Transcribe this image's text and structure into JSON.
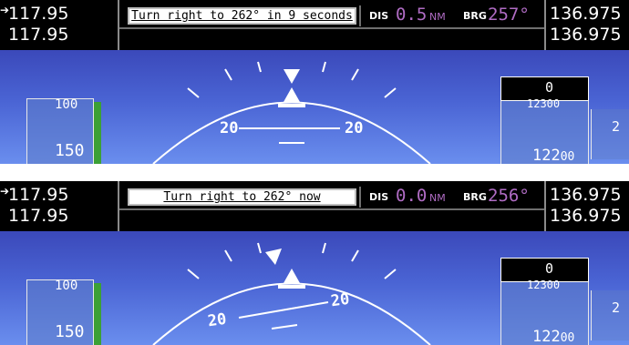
{
  "panels": [
    {
      "nav_freq_active": "117.95",
      "nav_freq_standby": "117.95",
      "message": "Turn right to 262° in 9 seconds",
      "dis_label": "DIS",
      "dis_value": "0.5",
      "dis_unit": "NM",
      "brg_label": "BRG",
      "brg_value": "257°",
      "com_freq_active": "136.975",
      "com_freq_standby": "136.975",
      "airspeed_top": "100",
      "airspeed": "150",
      "pitch_left": "20",
      "pitch_right": "20",
      "selected_altitude": "0",
      "altitude_top": "12300",
      "altitude_major": "122",
      "altitude_minor": "00",
      "vertical_speed": "2"
    },
    {
      "nav_freq_active": "117.95",
      "nav_freq_standby": "117.95",
      "message": "Turn right to 262° now",
      "dis_label": "DIS",
      "dis_value": "0.0",
      "dis_unit": "NM",
      "brg_label": "BRG",
      "brg_value": "256°",
      "com_freq_active": "136.975",
      "com_freq_standby": "136.975",
      "airspeed_top": "100",
      "airspeed": "150",
      "pitch_left": "20",
      "pitch_right": "20",
      "selected_altitude": "0",
      "altitude_top": "12300",
      "altitude_major": "122",
      "altitude_minor": "00",
      "vertical_speed": "2"
    }
  ],
  "colors": {
    "bearing_magenta": "#b06cc4",
    "sky_blue": "#4a64d4",
    "speed_green": "#3ca036"
  },
  "icons": [
    "active-frequency-arrow-icon",
    "aircraft-symbol-icon",
    "selected-altitude-bug-icon"
  ]
}
